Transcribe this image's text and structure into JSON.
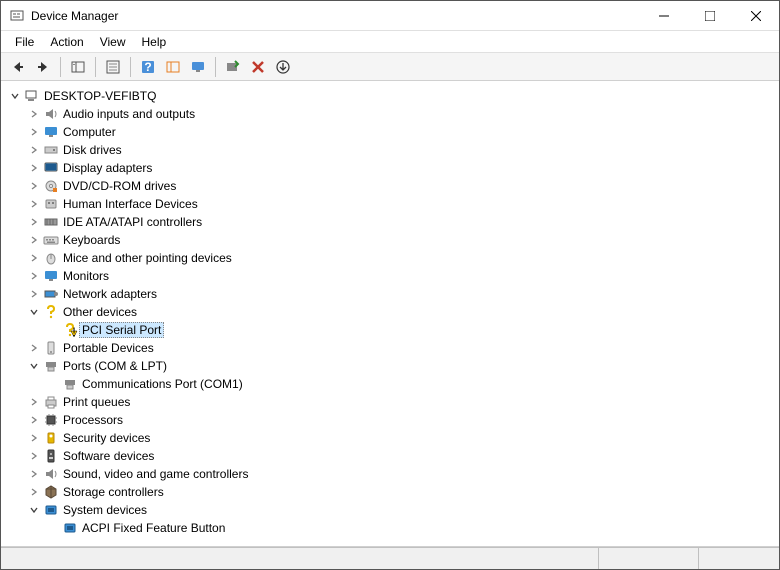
{
  "window": {
    "title": "Device Manager"
  },
  "menu": {
    "file": "File",
    "action": "Action",
    "view": "View",
    "help": "Help"
  },
  "tree": {
    "root": {
      "label": "DESKTOP-VEFIBTQ",
      "icon": "computer"
    },
    "categories": [
      {
        "label": "Audio inputs and outputs",
        "expanded": false,
        "icon": "speaker"
      },
      {
        "label": "Computer",
        "expanded": false,
        "icon": "monitor-blue"
      },
      {
        "label": "Disk drives",
        "expanded": false,
        "icon": "drive"
      },
      {
        "label": "Display adapters",
        "expanded": false,
        "icon": "display"
      },
      {
        "label": "DVD/CD-ROM drives",
        "expanded": false,
        "icon": "cdrom"
      },
      {
        "label": "Human Interface Devices",
        "expanded": false,
        "icon": "hid"
      },
      {
        "label": "IDE ATA/ATAPI controllers",
        "expanded": false,
        "icon": "ide"
      },
      {
        "label": "Keyboards",
        "expanded": false,
        "icon": "keyboard"
      },
      {
        "label": "Mice and other pointing devices",
        "expanded": false,
        "icon": "mouse"
      },
      {
        "label": "Monitors",
        "expanded": false,
        "icon": "monitor-blue"
      },
      {
        "label": "Network adapters",
        "expanded": false,
        "icon": "network"
      },
      {
        "label": "Other devices",
        "expanded": true,
        "icon": "question",
        "children": [
          {
            "label": "PCI Serial Port",
            "icon": "question-warn",
            "selected": true
          }
        ]
      },
      {
        "label": "Portable Devices",
        "expanded": false,
        "icon": "portable"
      },
      {
        "label": "Ports (COM & LPT)",
        "expanded": true,
        "icon": "port",
        "children": [
          {
            "label": "Communications Port (COM1)",
            "icon": "port"
          }
        ]
      },
      {
        "label": "Print queues",
        "expanded": false,
        "icon": "printer"
      },
      {
        "label": "Processors",
        "expanded": false,
        "icon": "processor"
      },
      {
        "label": "Security devices",
        "expanded": false,
        "icon": "security"
      },
      {
        "label": "Software devices",
        "expanded": false,
        "icon": "software"
      },
      {
        "label": "Sound, video and game controllers",
        "expanded": false,
        "icon": "speaker"
      },
      {
        "label": "Storage controllers",
        "expanded": false,
        "icon": "storage"
      },
      {
        "label": "System devices",
        "expanded": true,
        "icon": "system-blue",
        "children": [
          {
            "label": "ACPI Fixed Feature Button",
            "icon": "system-blue"
          }
        ]
      }
    ]
  }
}
